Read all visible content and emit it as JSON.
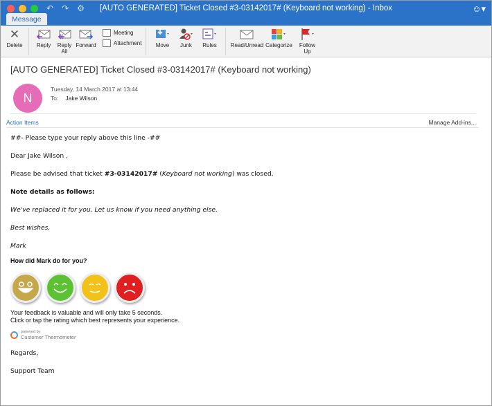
{
  "window": {
    "title": "[AUTO GENERATED] Ticket Closed #3-03142017# (Keyboard not working) - Inbox"
  },
  "tabs": [
    {
      "label": "Message",
      "active": true
    }
  ],
  "ribbon": {
    "delete": "Delete",
    "reply": "Reply",
    "reply_all_1": "Reply",
    "reply_all_2": "All",
    "forward": "Forward",
    "meeting": "Meeting",
    "attachment": "Attachment",
    "move": "Move",
    "junk": "Junk",
    "rules": "Rules",
    "read_unread": "Read/Unread",
    "categorize": "Categorize",
    "follow_up_1": "Follow",
    "follow_up_2": "Up"
  },
  "message": {
    "subject": "[AUTO GENERATED] Ticket Closed #3-03142017# (Keyboard not working)",
    "avatar_initial": "N",
    "date": "Tuesday, 14 March 2017 at 13:44",
    "to_label": "To:",
    "to_name": "Jake Wilson"
  },
  "actionbar": {
    "action_items": "Action Items",
    "manage_addins": "Manage Add-ins..."
  },
  "body": {
    "reply_line": "##- Please type your reply above this line -##",
    "greeting": "Dear Jake Wilson ,",
    "advised_pre": "Please be advised that ticket ",
    "ticket_id": "#3-03142017#",
    "advised_mid": " (",
    "ticket_title": "Keyboard not working",
    "advised_post": ") was closed.",
    "note_heading": "Note details as follows:",
    "note_text": "We've replaced it for you. Let us know if you need anything else.",
    "sign_off": "Best wishes,",
    "agent": "Mark",
    "rating_question": "How did Mark do for you?",
    "feedback_line1": "Your feedback is valuable and will only take 5 seconds.",
    "feedback_line2": "Click or tap the rating which best represents your experience.",
    "powered_by": "powered by",
    "powered_brand": "Customer Thermometer",
    "regards": "Regards,",
    "team": "Support Team"
  },
  "ratings": [
    {
      "name": "rating-gold-face",
      "color": "#c6a84a"
    },
    {
      "name": "rating-green-face",
      "color": "#5cc234"
    },
    {
      "name": "rating-yellow-face",
      "color": "#f2c21a"
    },
    {
      "name": "rating-red-face",
      "color": "#e02020"
    }
  ]
}
